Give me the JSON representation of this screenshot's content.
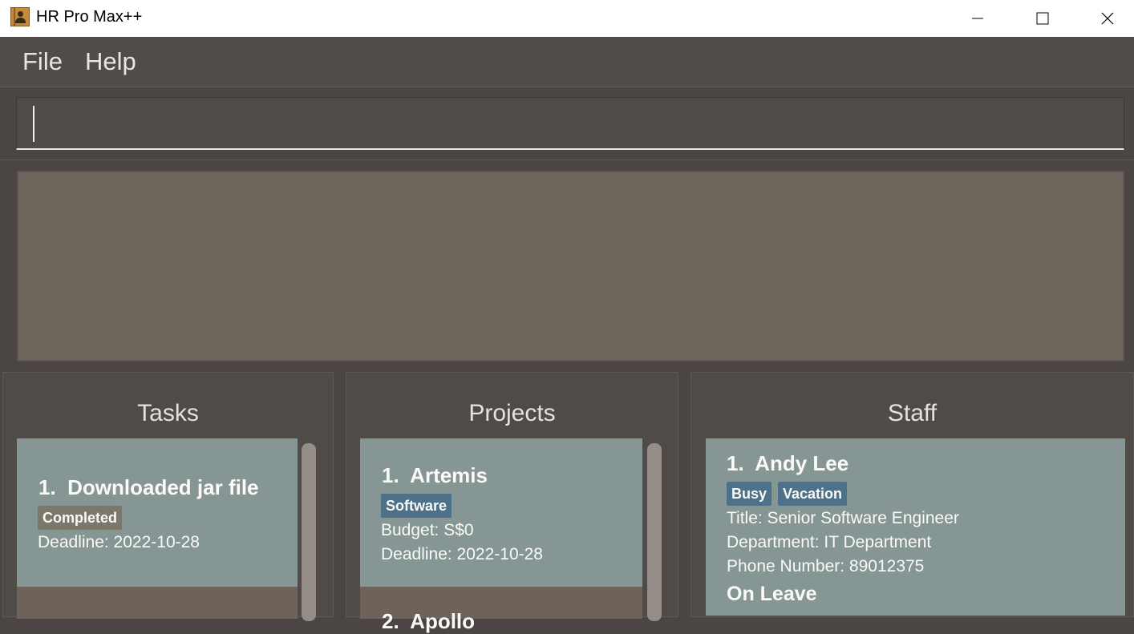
{
  "window": {
    "title": "HR Pro Max++",
    "icon": "address-book-icon",
    "controls": [
      "minimize-icon",
      "maximize-icon",
      "close-icon"
    ]
  },
  "menu": {
    "file": "File",
    "help": "Help"
  },
  "command": {
    "value": ""
  },
  "result": {
    "text": ""
  },
  "tasks": {
    "title": "Tasks",
    "items": [
      {
        "index": "1.",
        "name": "Downloaded jar file",
        "status": "Completed",
        "deadline": "Deadline: 2022-10-28"
      }
    ]
  },
  "projects": {
    "title": "Projects",
    "items": [
      {
        "index": "1.",
        "name": "Artemis",
        "tag": "Software",
        "budget": "Budget: S$0",
        "deadline": "Deadline: 2022-10-28"
      }
    ]
  },
  "staff": {
    "title": "Staff",
    "items": [
      {
        "index": "1.",
        "name": "Andy Lee",
        "tags": [
          "Busy",
          "Vacation"
        ],
        "title": "Title: Senior Software Engineer",
        "department": "Department: IT Department",
        "phone": "Phone Number: 89012375",
        "leave": "On Leave"
      }
    ]
  },
  "colors": {
    "background": "#4b4643",
    "card": "#859694",
    "card_alt": "#6d635a",
    "tag_blue": "#4d7188",
    "tag_completed": "#79786a"
  }
}
